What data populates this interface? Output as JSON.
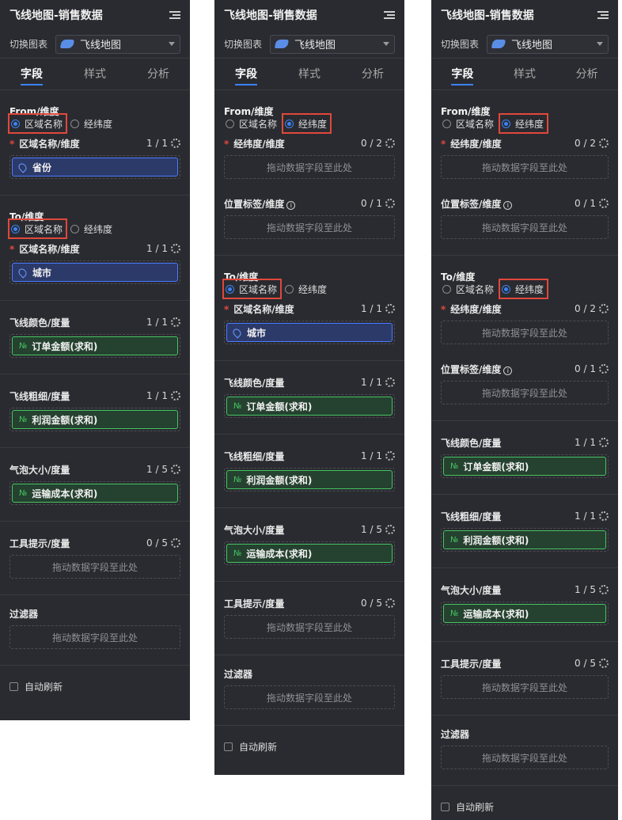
{
  "panels": [
    {
      "title": "飞线地图-销售数据",
      "switch_label": "切换图表",
      "chart_type": "飞线地图",
      "tabs": [
        "字段",
        "样式",
        "分析"
      ],
      "from": {
        "title": "From/维度",
        "opt_a": "区域名称",
        "opt_b": "经纬度",
        "field_name": "区域名称/维度",
        "count": "1 / 1",
        "pill": "省份"
      },
      "to": {
        "title": "To/维度",
        "opt_a": "区域名称",
        "opt_b": "经纬度",
        "field_name": "区域名称/维度",
        "count": "1 / 1",
        "pill": "城市"
      },
      "color": {
        "name": "飞线颜色/度量",
        "count": "1 / 1",
        "pill": "订单金额(求和)"
      },
      "width": {
        "name": "飞线粗细/度量",
        "count": "1 / 1",
        "pill": "利润金额(求和)"
      },
      "bubble": {
        "name": "气泡大小/度量",
        "count": "1 / 5",
        "pill": "运输成本(求和)"
      },
      "tooltip": {
        "name": "工具提示/度量",
        "count": "0 / 5",
        "drop": "拖动数据字段至此处"
      },
      "filter": {
        "name": "过滤器",
        "drop": "拖动数据字段至此处"
      },
      "auto_refresh": "自动刷新"
    },
    {
      "title": "飞线地图-销售数据",
      "switch_label": "切换图表",
      "chart_type": "飞线地图",
      "tabs": [
        "字段",
        "样式",
        "分析"
      ],
      "from": {
        "title": "From/维度",
        "opt_a": "区域名称",
        "opt_b": "经纬度",
        "field_name": "经纬度/维度",
        "count": "0 / 2",
        "drop": "拖动数据字段至此处",
        "label_name": "位置标签/维度",
        "label_count": "0 / 1",
        "label_drop": "拖动数据字段至此处"
      },
      "to": {
        "title": "To/维度",
        "opt_a": "区域名称",
        "opt_b": "经纬度",
        "field_name": "区域名称/维度",
        "count": "1 / 1",
        "pill": "城市"
      },
      "color": {
        "name": "飞线颜色/度量",
        "count": "1 / 1",
        "pill": "订单金额(求和)"
      },
      "width": {
        "name": "飞线粗细/度量",
        "count": "1 / 1",
        "pill": "利润金额(求和)"
      },
      "bubble": {
        "name": "气泡大小/度量",
        "count": "1 / 5",
        "pill": "运输成本(求和)"
      },
      "tooltip": {
        "name": "工具提示/度量",
        "count": "0 / 5",
        "drop": "拖动数据字段至此处"
      },
      "filter": {
        "name": "过滤器",
        "drop": "拖动数据字段至此处"
      },
      "auto_refresh": "自动刷新"
    },
    {
      "title": "飞线地图-销售数据",
      "switch_label": "切换图表",
      "chart_type": "飞线地图",
      "tabs": [
        "字段",
        "样式",
        "分析"
      ],
      "from": {
        "title": "From/维度",
        "opt_a": "区域名称",
        "opt_b": "经纬度",
        "field_name": "经纬度/维度",
        "count": "0 / 2",
        "drop": "拖动数据字段至此处",
        "label_name": "位置标签/维度",
        "label_count": "0 / 1",
        "label_drop": "拖动数据字段至此处"
      },
      "to": {
        "title": "To/维度",
        "opt_a": "区域名称",
        "opt_b": "经纬度",
        "field_name": "经纬度/维度",
        "count": "0 / 2",
        "drop": "拖动数据字段至此处",
        "label_name": "位置标签/维度",
        "label_count": "0 / 1",
        "label_drop": "拖动数据字段至此处"
      },
      "color": {
        "name": "飞线颜色/度量",
        "count": "1 / 1",
        "pill": "订单金额(求和)"
      },
      "width": {
        "name": "飞线粗细/度量",
        "count": "1 / 1",
        "pill": "利润金额(求和)"
      },
      "bubble": {
        "name": "气泡大小/度量",
        "count": "1 / 5",
        "pill": "运输成本(求和)"
      },
      "tooltip": {
        "name": "工具提示/度量",
        "count": "0 / 5",
        "drop": "拖动数据字段至此处"
      },
      "filter": {
        "name": "过滤器",
        "drop": "拖动数据字段至此处"
      },
      "auto_refresh": "自动刷新"
    }
  ],
  "measure_badge": "№",
  "info_glyph": "i",
  "colors": {
    "panel_bg": "#2a2b30",
    "accent": "#3b82f6",
    "highlight": "#e0483c",
    "measure": "#45c463"
  }
}
